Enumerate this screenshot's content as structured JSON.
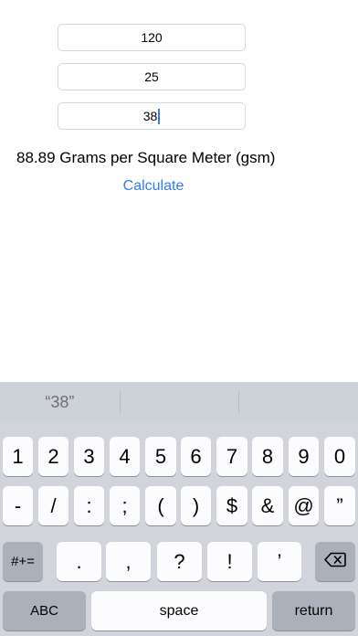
{
  "form": {
    "field1_value": "120",
    "field2_value": "25",
    "field3_value": "38",
    "result_text": "88.89 Grams per Square Meter (gsm)",
    "calculate_label": "Calculate"
  },
  "keyboard": {
    "suggestions": [
      "“38”",
      "",
      ""
    ],
    "row1": [
      "1",
      "2",
      "3",
      "4",
      "5",
      "6",
      "7",
      "8",
      "9",
      "0"
    ],
    "row2": [
      "-",
      "/",
      ":",
      ";",
      "(",
      ")",
      "$",
      "&",
      "@",
      "”"
    ],
    "row3": {
      "mode_key": "#+=",
      "keys": [
        ".",
        ",",
        "?",
        "!",
        "’"
      ],
      "backspace_icon": "backspace-icon"
    },
    "row4": {
      "abc": "ABC",
      "space": "space",
      "return": "return"
    }
  }
}
